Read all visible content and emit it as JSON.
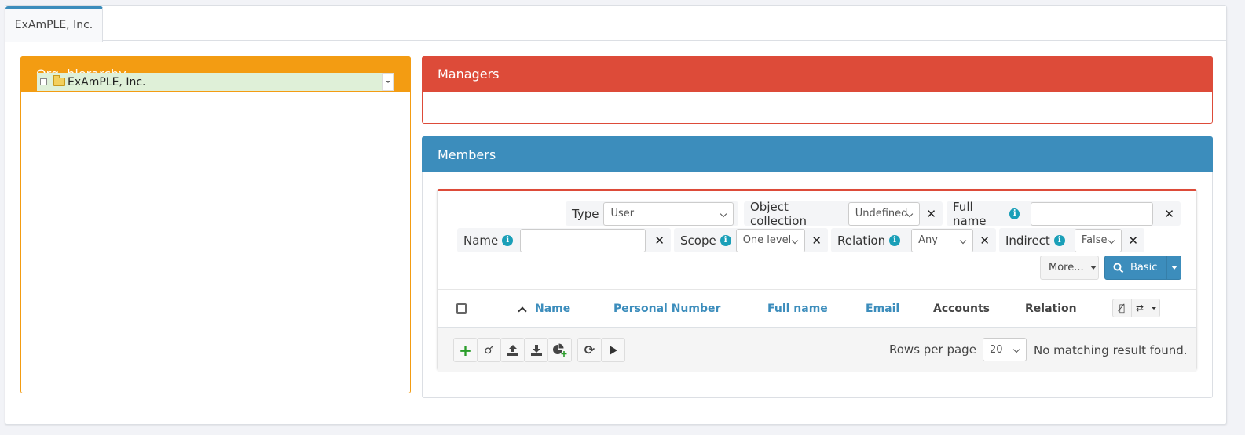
{
  "tabs": [
    {
      "label": "ExAmPLE, Inc.",
      "active": true
    }
  ],
  "org_hierarchy": {
    "title": "Org. hierarchy",
    "tree": [
      {
        "label": "ExAmPLE, Inc.",
        "expanded": true,
        "selected": true,
        "icon": "folder-icon"
      }
    ]
  },
  "managers": {
    "title": "Managers"
  },
  "members": {
    "title": "Members",
    "filters": {
      "type": {
        "label": "Type",
        "value": "User"
      },
      "object_collection": {
        "label": "Object collection",
        "value": "Undefined"
      },
      "full_name": {
        "label": "Full name",
        "value": ""
      },
      "name": {
        "label": "Name",
        "value": ""
      },
      "scope": {
        "label": "Scope",
        "value": "One level"
      },
      "relation": {
        "label": "Relation",
        "value": "Any"
      },
      "indirect": {
        "label": "Indirect",
        "value": "False"
      }
    },
    "more_label": "More...",
    "search_label": "Basic",
    "columns": [
      {
        "label": "Name",
        "sortable": true,
        "sorted": "asc"
      },
      {
        "label": "Personal Number",
        "sortable": true
      },
      {
        "label": "Full name",
        "sortable": true
      },
      {
        "label": "Email",
        "sortable": true
      },
      {
        "label": "Accounts",
        "sortable": false
      },
      {
        "label": "Relation",
        "sortable": false
      }
    ],
    "toolbar": [
      "add-icon",
      "assign-icon",
      "export-icon",
      "import-icon",
      "report-add-icon",
      "refresh-icon",
      "play-icon"
    ],
    "rows_per_page_label": "Rows per page",
    "rows_per_page": "20",
    "empty_message": "No matching result found."
  },
  "colors": {
    "org": "#f39c12",
    "managers": "#dd4b39",
    "members": "#3c8dbc",
    "info": "#1a9fb8"
  }
}
